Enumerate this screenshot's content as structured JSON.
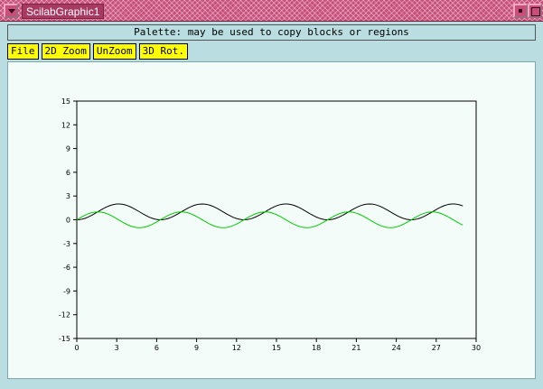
{
  "window": {
    "title": "ScilabGraphic1"
  },
  "infobar": {
    "text": "Palette: may be used to copy  blocks or regions"
  },
  "menu": {
    "items": [
      {
        "label": "File"
      },
      {
        "label": "2D Zoom"
      },
      {
        "label": "UnZoom"
      },
      {
        "label": "3D Rot."
      }
    ]
  },
  "chart_data": {
    "type": "line",
    "xlim": [
      0,
      30
    ],
    "ylim": [
      -15,
      15
    ],
    "x_ticks": [
      0,
      3,
      6,
      9,
      12,
      15,
      18,
      21,
      24,
      27,
      30
    ],
    "y_ticks": [
      -15,
      -12,
      -9,
      -6,
      -3,
      0,
      3,
      6,
      9,
      12,
      15
    ],
    "grid": false,
    "series": [
      {
        "color": "#000000",
        "x_start": 0,
        "x_end": 29,
        "formula": "1 - cos(x)",
        "samples": 146
      },
      {
        "color": "#00cc00",
        "x_start": 0,
        "x_end": 29,
        "formula": "sin(x)",
        "samples": 146
      }
    ]
  }
}
